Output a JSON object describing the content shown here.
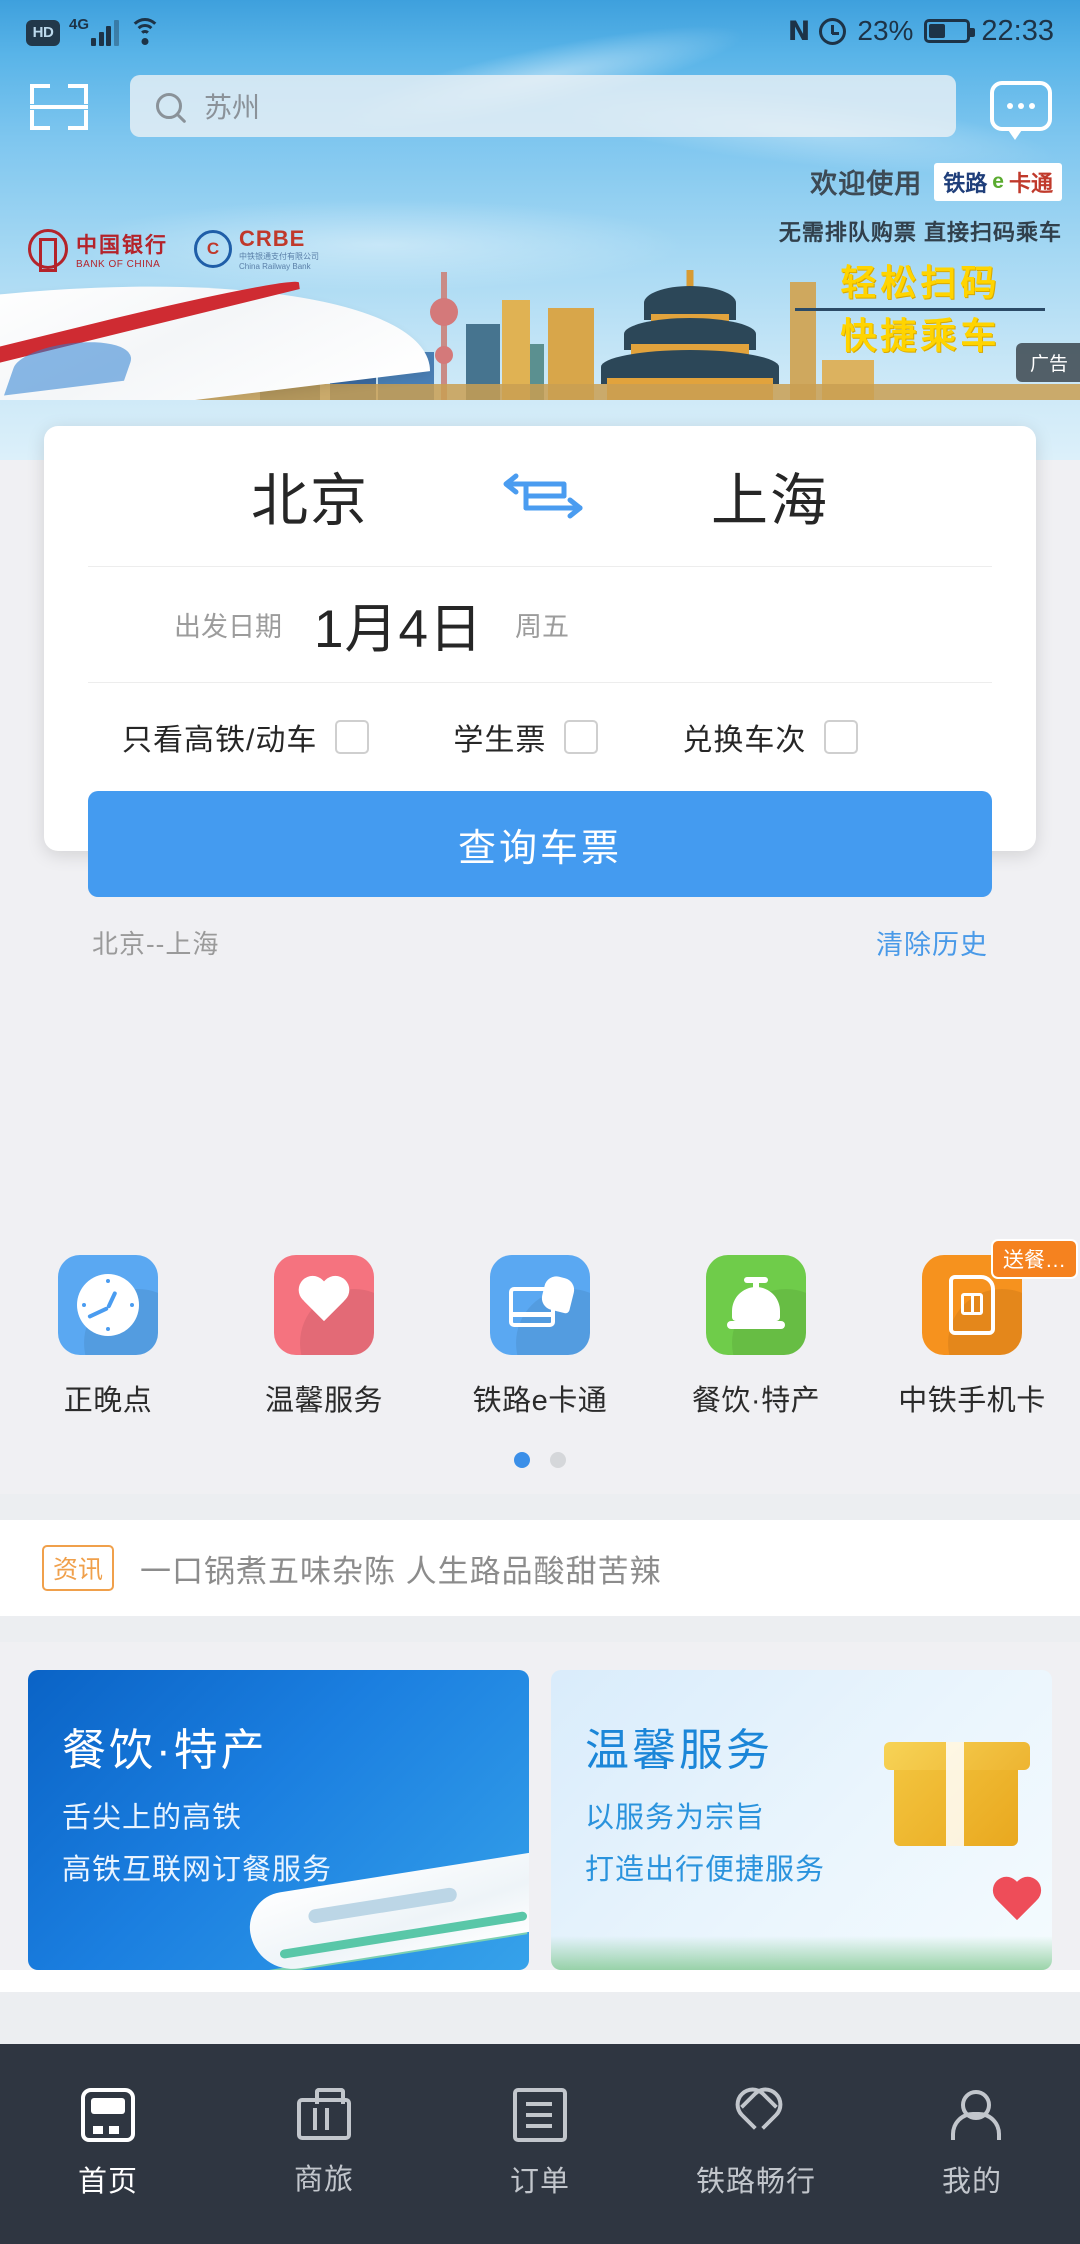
{
  "status_bar": {
    "hd_label": "HD",
    "network_label": "4G",
    "signal_icon": "signal-bars-icon",
    "wifi_icon": "wifi-icon",
    "nfc_icon": "nfc-icon",
    "alarm_icon": "alarm-clock-icon",
    "battery_percent": "23%",
    "battery_icon": "battery-icon",
    "time": "22:33"
  },
  "header": {
    "scan_icon": "scan-qr-icon",
    "search_value": "苏州",
    "search_icon": "search-icon",
    "message_icon": "message-bubble-icon"
  },
  "ad_banner": {
    "bank_name_cn": "中国银行",
    "bank_name_en": "BANK OF CHINA",
    "crbe_name": "CRBE",
    "crbe_sub_line1": "中铁银通支付有限公司",
    "crbe_sub_line2": "China Railway Bank",
    "welcome_text": "欢迎使用",
    "ecard_part1": "铁路",
    "ecard_part2": "e",
    "ecard_part3": "卡通",
    "sub_text": "无需排队购票 直接扫码乘车",
    "slogan_line1": "轻松扫码",
    "slogan_line2": "快捷乘车",
    "ad_badge": "广告"
  },
  "booking": {
    "from_city": "北京",
    "to_city": "上海",
    "swap_icon": "swap-arrows-icon",
    "date_label": "出发日期",
    "date_value": "1月4日",
    "weekday": "周五",
    "options": [
      {
        "label": "只看高铁/动车",
        "checked": false
      },
      {
        "label": "学生票",
        "checked": false
      },
      {
        "label": "兑换车次",
        "checked": false
      }
    ],
    "search_button": "查询车票",
    "history_item": "北京--上海",
    "clear_history": "清除历史"
  },
  "services": [
    {
      "label": "正晚点",
      "icon": "clock-icon",
      "color": "#5aa8f2",
      "badge": ""
    },
    {
      "label": "温馨服务",
      "icon": "heart-icon",
      "color": "#f5737f",
      "badge": ""
    },
    {
      "label": "铁路e卡通",
      "icon": "card-swipe-icon",
      "color": "#5aa8f2",
      "badge": ""
    },
    {
      "label": "餐饮·特产",
      "icon": "bell-service-icon",
      "color": "#6fcc4a",
      "badge": ""
    },
    {
      "label": "中铁手机卡",
      "icon": "sim-card-icon",
      "color": "#f6921e",
      "badge": "送餐…"
    }
  ],
  "pager": {
    "total": 2,
    "active": 0
  },
  "news": {
    "tag": "资讯",
    "headline": "一口锅煮五味杂陈  人生路品酸甜苦辣"
  },
  "promos": [
    {
      "title": "餐饮·特产",
      "line1": "舌尖上的高铁",
      "line2": "高铁互联网订餐服务",
      "art": "high-speed-train-art"
    },
    {
      "title": "温馨服务",
      "line1": "以服务为宗旨",
      "line2": "打造出行便捷服务",
      "art": "gift-heart-art"
    }
  ],
  "tabbar": [
    {
      "label": "首页",
      "icon": "home-train-icon",
      "active": true
    },
    {
      "label": "商旅",
      "icon": "briefcase-icon",
      "active": false
    },
    {
      "label": "订单",
      "icon": "order-list-icon",
      "active": false
    },
    {
      "label": "铁路畅行",
      "icon": "heart-outline-icon",
      "active": false
    },
    {
      "label": "我的",
      "icon": "user-icon",
      "active": false
    }
  ],
  "colors": {
    "accent": "#449bf0",
    "tabbar_bg": "#2f3641",
    "page_bg": "#eceef1"
  }
}
